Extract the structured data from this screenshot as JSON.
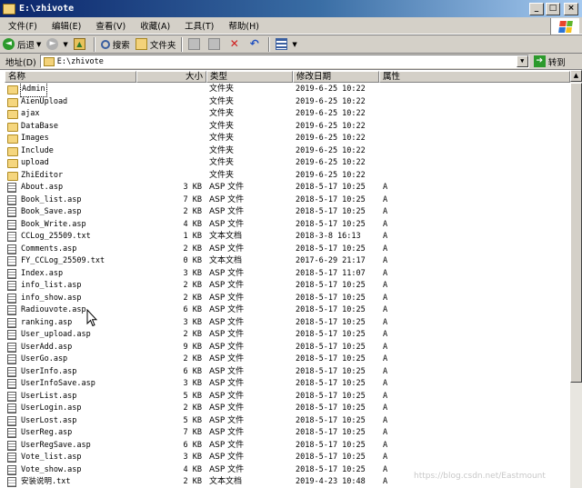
{
  "window": {
    "title": "E:\\zhivote",
    "buttons": {
      "minimize": "_",
      "maximize": "□",
      "close": "×"
    }
  },
  "menu": [
    "文件(F)",
    "编辑(E)",
    "查看(V)",
    "收藏(A)",
    "工具(T)",
    "帮助(H)"
  ],
  "toolbar": {
    "back": "后退",
    "search": "搜索",
    "folders": "文件夹"
  },
  "address": {
    "label": "地址(D)",
    "path": "E:\\zhivote",
    "go": "转到"
  },
  "columns": {
    "name": "名称",
    "size": "大小",
    "type": "类型",
    "modified": "修改日期",
    "attributes": "属性"
  },
  "files": [
    {
      "name": "Admin",
      "size": "",
      "type": "文件夹",
      "date": "2019-6-25 10:22",
      "attr": "",
      "kind": "folder"
    },
    {
      "name": "AienUpload",
      "size": "",
      "type": "文件夹",
      "date": "2019-6-25 10:22",
      "attr": "",
      "kind": "folder"
    },
    {
      "name": "ajax",
      "size": "",
      "type": "文件夹",
      "date": "2019-6-25 10:22",
      "attr": "",
      "kind": "folder"
    },
    {
      "name": "DataBase",
      "size": "",
      "type": "文件夹",
      "date": "2019-6-25 10:22",
      "attr": "",
      "kind": "folder"
    },
    {
      "name": "Images",
      "size": "",
      "type": "文件夹",
      "date": "2019-6-25 10:22",
      "attr": "",
      "kind": "folder"
    },
    {
      "name": "Include",
      "size": "",
      "type": "文件夹",
      "date": "2019-6-25 10:22",
      "attr": "",
      "kind": "folder"
    },
    {
      "name": "upload",
      "size": "",
      "type": "文件夹",
      "date": "2019-6-25 10:22",
      "attr": "",
      "kind": "folder"
    },
    {
      "name": "ZhiEditor",
      "size": "",
      "type": "文件夹",
      "date": "2019-6-25 10:22",
      "attr": "",
      "kind": "folder"
    },
    {
      "name": "About.asp",
      "size": "3 KB",
      "type": "ASP 文件",
      "date": "2018-5-17 10:25",
      "attr": "A",
      "kind": "file"
    },
    {
      "name": "Book_list.asp",
      "size": "7 KB",
      "type": "ASP 文件",
      "date": "2018-5-17 10:25",
      "attr": "A",
      "kind": "file"
    },
    {
      "name": "Book_Save.asp",
      "size": "2 KB",
      "type": "ASP 文件",
      "date": "2018-5-17 10:25",
      "attr": "A",
      "kind": "file"
    },
    {
      "name": "Book_Write.asp",
      "size": "4 KB",
      "type": "ASP 文件",
      "date": "2018-5-17 10:25",
      "attr": "A",
      "kind": "file"
    },
    {
      "name": "CCLog_25509.txt",
      "size": "1 KB",
      "type": "文本文档",
      "date": "2018-3-8 16:13",
      "attr": "A",
      "kind": "txt"
    },
    {
      "name": "Comments.asp",
      "size": "2 KB",
      "type": "ASP 文件",
      "date": "2018-5-17 10:25",
      "attr": "A",
      "kind": "file"
    },
    {
      "name": "FY_CCLog_25509.txt",
      "size": "0 KB",
      "type": "文本文档",
      "date": "2017-6-29 21:17",
      "attr": "A",
      "kind": "txt"
    },
    {
      "name": "Index.asp",
      "size": "3 KB",
      "type": "ASP 文件",
      "date": "2018-5-17 11:07",
      "attr": "A",
      "kind": "file"
    },
    {
      "name": "info_list.asp",
      "size": "2 KB",
      "type": "ASP 文件",
      "date": "2018-5-17 10:25",
      "attr": "A",
      "kind": "file"
    },
    {
      "name": "info_show.asp",
      "size": "2 KB",
      "type": "ASP 文件",
      "date": "2018-5-17 10:25",
      "attr": "A",
      "kind": "file"
    },
    {
      "name": "Radiouvote.asp",
      "size": "6 KB",
      "type": "ASP 文件",
      "date": "2018-5-17 10:25",
      "attr": "A",
      "kind": "file"
    },
    {
      "name": "ranking.asp",
      "size": "3 KB",
      "type": "ASP 文件",
      "date": "2018-5-17 10:25",
      "attr": "A",
      "kind": "file"
    },
    {
      "name": "User_upload.asp",
      "size": "2 KB",
      "type": "ASP 文件",
      "date": "2018-5-17 10:25",
      "attr": "A",
      "kind": "file"
    },
    {
      "name": "UserAdd.asp",
      "size": "9 KB",
      "type": "ASP 文件",
      "date": "2018-5-17 10:25",
      "attr": "A",
      "kind": "file"
    },
    {
      "name": "UserGo.asp",
      "size": "2 KB",
      "type": "ASP 文件",
      "date": "2018-5-17 10:25",
      "attr": "A",
      "kind": "file"
    },
    {
      "name": "UserInfo.asp",
      "size": "6 KB",
      "type": "ASP 文件",
      "date": "2018-5-17 10:25",
      "attr": "A",
      "kind": "file"
    },
    {
      "name": "UserInfoSave.asp",
      "size": "3 KB",
      "type": "ASP 文件",
      "date": "2018-5-17 10:25",
      "attr": "A",
      "kind": "file"
    },
    {
      "name": "UserList.asp",
      "size": "5 KB",
      "type": "ASP 文件",
      "date": "2018-5-17 10:25",
      "attr": "A",
      "kind": "file"
    },
    {
      "name": "UserLogin.asp",
      "size": "2 KB",
      "type": "ASP 文件",
      "date": "2018-5-17 10:25",
      "attr": "A",
      "kind": "file"
    },
    {
      "name": "UserLost.asp",
      "size": "5 KB",
      "type": "ASP 文件",
      "date": "2018-5-17 10:25",
      "attr": "A",
      "kind": "file"
    },
    {
      "name": "UserReg.asp",
      "size": "7 KB",
      "type": "ASP 文件",
      "date": "2018-5-17 10:25",
      "attr": "A",
      "kind": "file"
    },
    {
      "name": "UserRegSave.asp",
      "size": "6 KB",
      "type": "ASP 文件",
      "date": "2018-5-17 10:25",
      "attr": "A",
      "kind": "file"
    },
    {
      "name": "Vote_list.asp",
      "size": "3 KB",
      "type": "ASP 文件",
      "date": "2018-5-17 10:25",
      "attr": "A",
      "kind": "file"
    },
    {
      "name": "Vote_show.asp",
      "size": "4 KB",
      "type": "ASP 文件",
      "date": "2018-5-17 10:25",
      "attr": "A",
      "kind": "file"
    },
    {
      "name": "安装说明.txt",
      "size": "2 KB",
      "type": "文本文档",
      "date": "2019-4-23 10:48",
      "attr": "A",
      "kind": "txt"
    }
  ],
  "watermark": "https://blog.csdn.net/Eastmount",
  "icons": {
    "back": "back-arrow-icon",
    "forward": "forward-arrow-icon",
    "up": "up-folder-icon",
    "search": "search-icon",
    "folders": "folders-icon",
    "delete": "delete-icon",
    "undo": "undo-icon",
    "views": "views-icon"
  }
}
